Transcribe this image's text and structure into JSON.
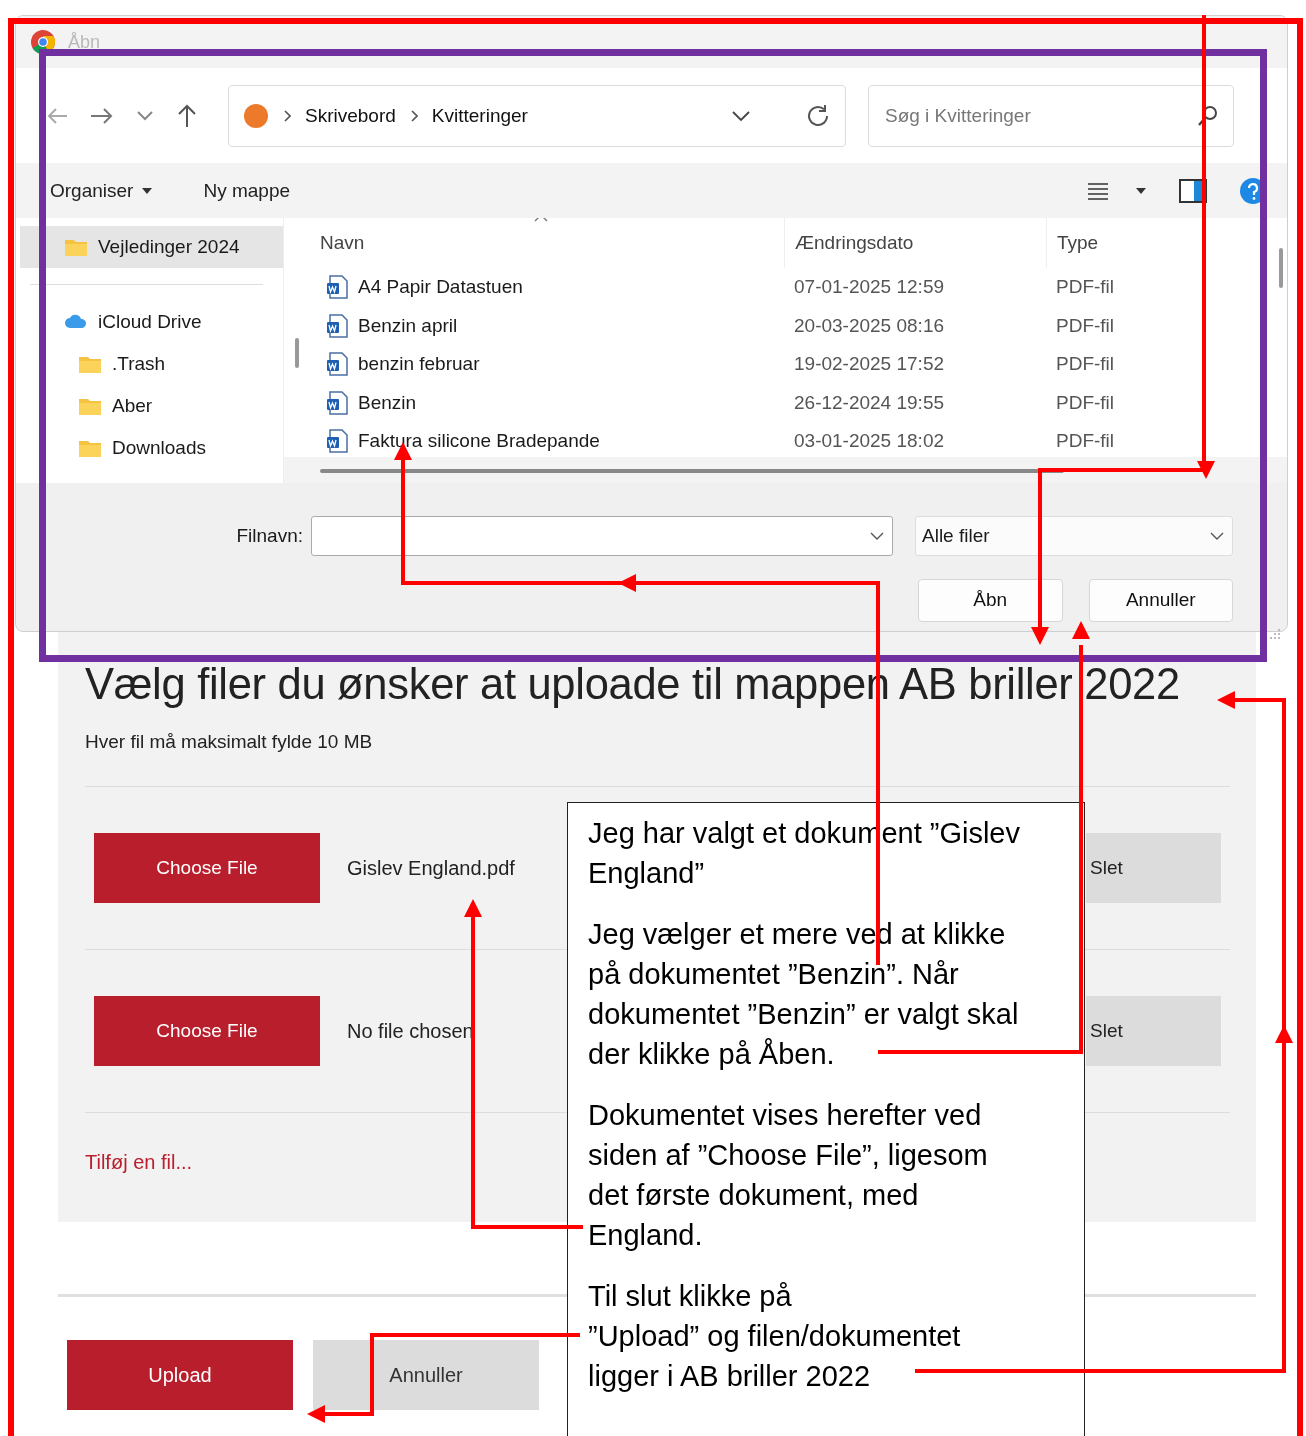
{
  "dialog": {
    "title": "Åbn",
    "address": [
      "Skrivebord",
      "Kvitteringer"
    ],
    "search": {
      "placeholder": "Søg i Kvitteringer"
    },
    "toolbar": [
      {
        "label": "Organiser",
        "kind": "menu"
      },
      {
        "label": "Ny mappe",
        "kind": "button"
      }
    ],
    "sidebar": [
      {
        "label": "Vejledinger 2024",
        "kind": "folder",
        "selected": true
      },
      {
        "label": "iCloud Drive",
        "kind": "cloud",
        "selected": false,
        "children": [
          {
            "label": ".Trash",
            "kind": "folder",
            "selected": false
          },
          {
            "label": "Aber",
            "kind": "folder",
            "selected": false
          },
          {
            "label": "Downloads",
            "kind": "folder",
            "selected": false
          }
        ]
      }
    ],
    "columns": [
      "Navn",
      "Ændringsdato",
      "Type"
    ],
    "files": [
      {
        "name": "A4 Papir Datastuen",
        "date": "07-01-2025 12:59",
        "type": "PDF-fil"
      },
      {
        "name": "Benzin april",
        "date": "20-03-2025 08:16",
        "type": "PDF-fil"
      },
      {
        "name": "benzin februar",
        "date": "19-02-2025 17:52",
        "type": "PDF-fil"
      },
      {
        "name": "Benzin",
        "date": "26-12-2024 19:55",
        "type": "PDF-fil"
      },
      {
        "name": "Faktura silicone Bradepande",
        "date": "03-01-2025 18:02",
        "type": "PDF-fil"
      }
    ],
    "filename": {
      "label": "Filnavn:"
    },
    "filter": "Alle filer",
    "buttons": [
      "Åbn",
      "Annuller"
    ]
  },
  "page": {
    "heading": "Vælg filer du ønsker at uploade til mappen AB briller 2022",
    "note": "Hver fil må maksimalt fylde 10 MB",
    "uploads": [
      {
        "button": "Choose File",
        "filename": "Gislev England.pdf",
        "delete": "Slet"
      },
      {
        "button": "Choose File",
        "filename": "No file chosen",
        "delete": "Slet"
      }
    ],
    "add_link": "Tilføj en fil...",
    "actions": [
      {
        "label": "Upload",
        "kind": "primary"
      },
      {
        "label": "Annuller",
        "kind": "secondary"
      }
    ]
  },
  "callout": [
    "Jeg har valgt et dokument ”Gislev\nEngland”",
    "Jeg vælger et mere ved at klikke\npå dokumentet ”Benzin”. Når\ndokumentet ”Benzin” er valgt skal\nder klikke på Åben.",
    "Dokumentet vises herefter ved\nsiden af ”Choose File”, ligesom\ndet første dokument, med\nEngland.",
    "Til slut klikke på\n”Upload” og filen/dokumentet\nligger i AB briller 2022"
  ]
}
